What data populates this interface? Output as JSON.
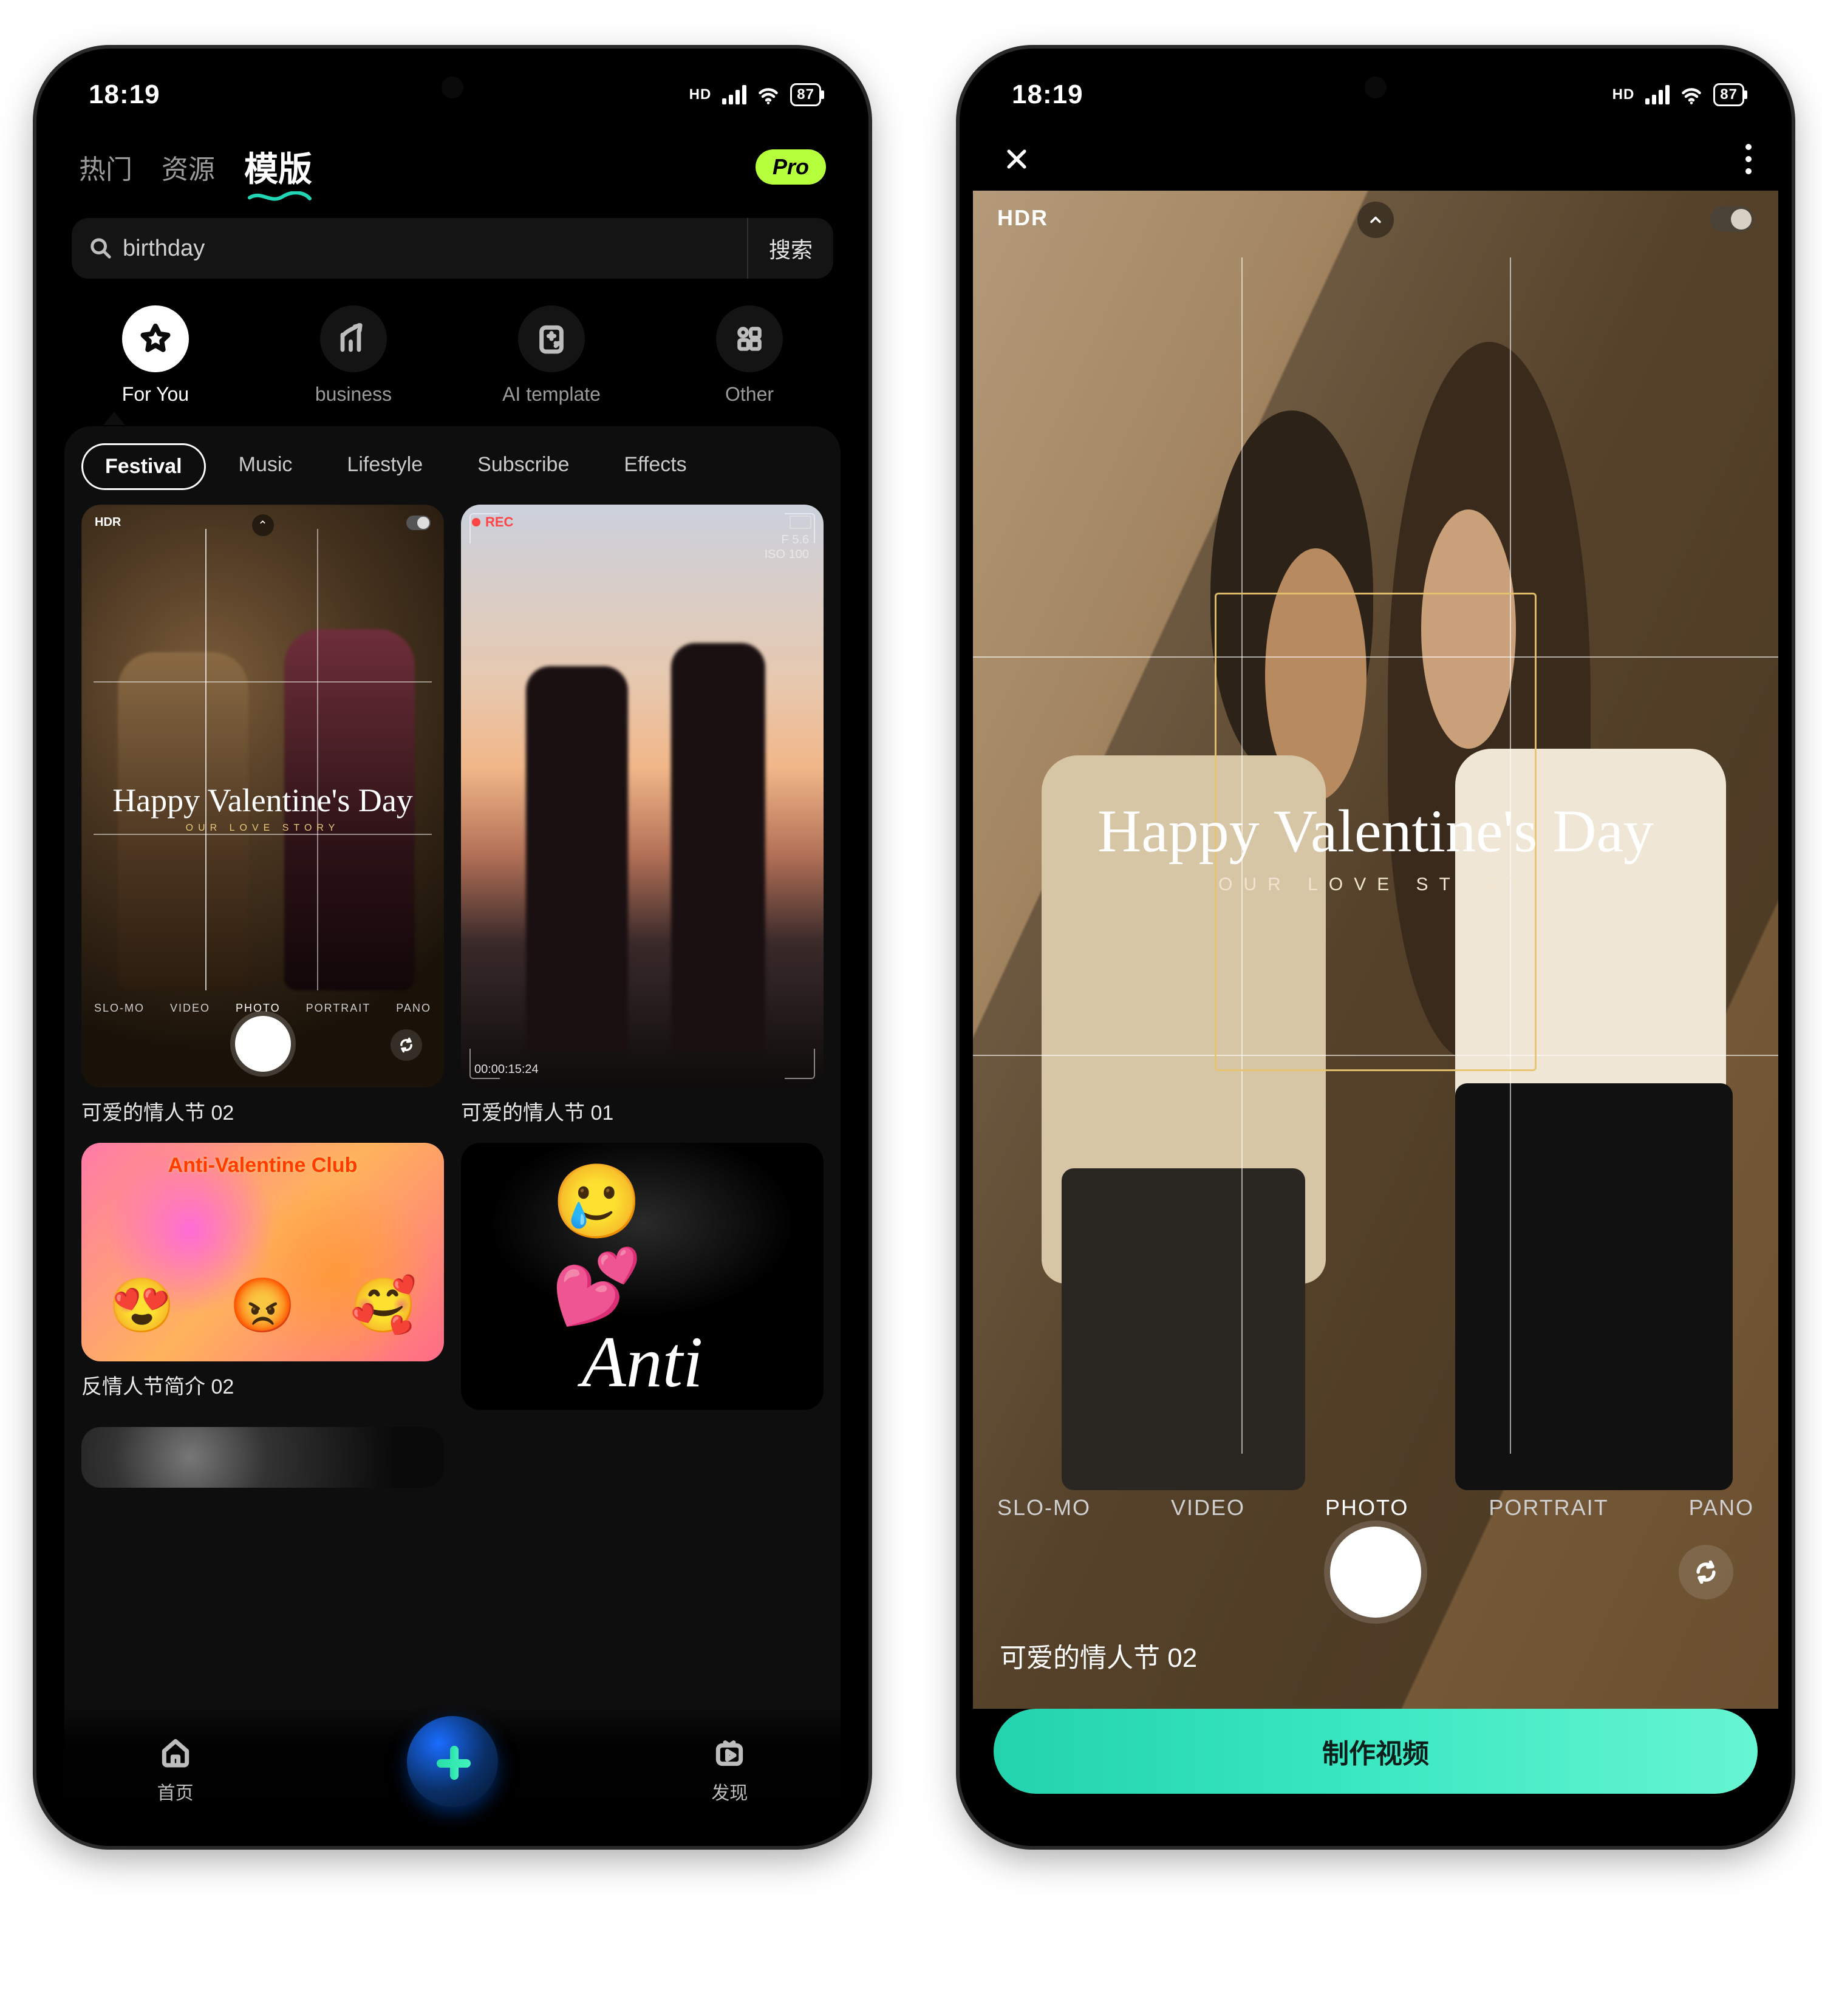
{
  "status": {
    "time": "18:19",
    "hd": "HD",
    "battery": "87"
  },
  "left": {
    "tabs": {
      "hot": "热门",
      "resources": "资源",
      "templates": "模版"
    },
    "pro": "Pro",
    "search": {
      "placeholder": "birthday",
      "button": "搜索"
    },
    "categories": [
      {
        "key": "foryou",
        "label": "For You"
      },
      {
        "key": "business",
        "label": "business"
      },
      {
        "key": "ai",
        "label": "AI template"
      },
      {
        "key": "other",
        "label": "Other"
      }
    ],
    "chips": [
      "Festival",
      "Music",
      "Lifestyle",
      "Subscribe",
      "Effects"
    ],
    "cards": {
      "c1": {
        "caption": "可爱的情人节 02",
        "hdr": "HDR",
        "title": "Happy Valentine's Day",
        "subtitle": "OUR LOVE STORY",
        "modes": [
          "SLO-MO",
          "VIDEO",
          "PHOTO",
          "PORTRAIT",
          "PANO"
        ]
      },
      "c2": {
        "caption": "可爱的情人节 01",
        "rec": "REC",
        "aperture": "F 5.6",
        "iso": "ISO 100",
        "timecode": "00:00:15:24"
      },
      "c3": {
        "caption": "反情人节简介 02",
        "banner": "Anti-Valentine Club"
      },
      "c4": {
        "text": "Anti"
      }
    },
    "nav": {
      "home": "首页",
      "discover": "发现"
    }
  },
  "right": {
    "hdr": "HDR",
    "title": "Happy Valentine's Day",
    "subtitle": "OUR LOVE STORY",
    "modes": [
      "SLO-MO",
      "VIDEO",
      "PHOTO",
      "PORTRAIT",
      "PANO"
    ],
    "selected_mode_index": 2,
    "caption": "可爱的情人节 02",
    "cta": "制作视频"
  }
}
